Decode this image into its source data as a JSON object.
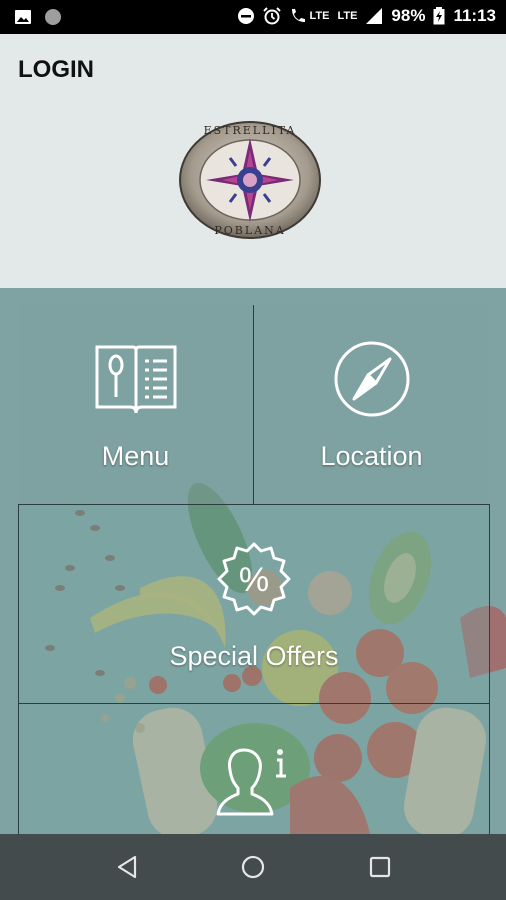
{
  "status_bar": {
    "icons_left": [
      "image-icon",
      "circle-icon"
    ],
    "icons_right": [
      "dnd-icon",
      "alarm-icon",
      "wifi-calling-icon",
      "signal-icon",
      "battery-icon"
    ],
    "lte1": "LTE",
    "lte2": "LTE",
    "battery": "98%",
    "time": "11:13"
  },
  "header": {
    "title": "LOGIN",
    "logo_text_top": "ESTRELLITA",
    "logo_text_bottom": "POBLANA"
  },
  "tiles": {
    "menu": {
      "label": "Menu",
      "icon": "menu-book-icon"
    },
    "location": {
      "label": "Location",
      "icon": "compass-icon"
    },
    "offers": {
      "label": "Special Offers",
      "icon": "percent-badge-icon"
    },
    "info": {
      "label": "",
      "icon": "user-info-icon"
    }
  },
  "navbar": {
    "buttons": [
      "back-icon",
      "home-icon",
      "recents-icon"
    ]
  },
  "colors": {
    "header_bg": "#e3e9e9",
    "grid_bg": "#7c9e9d",
    "navbar_bg": "#434b4c"
  }
}
